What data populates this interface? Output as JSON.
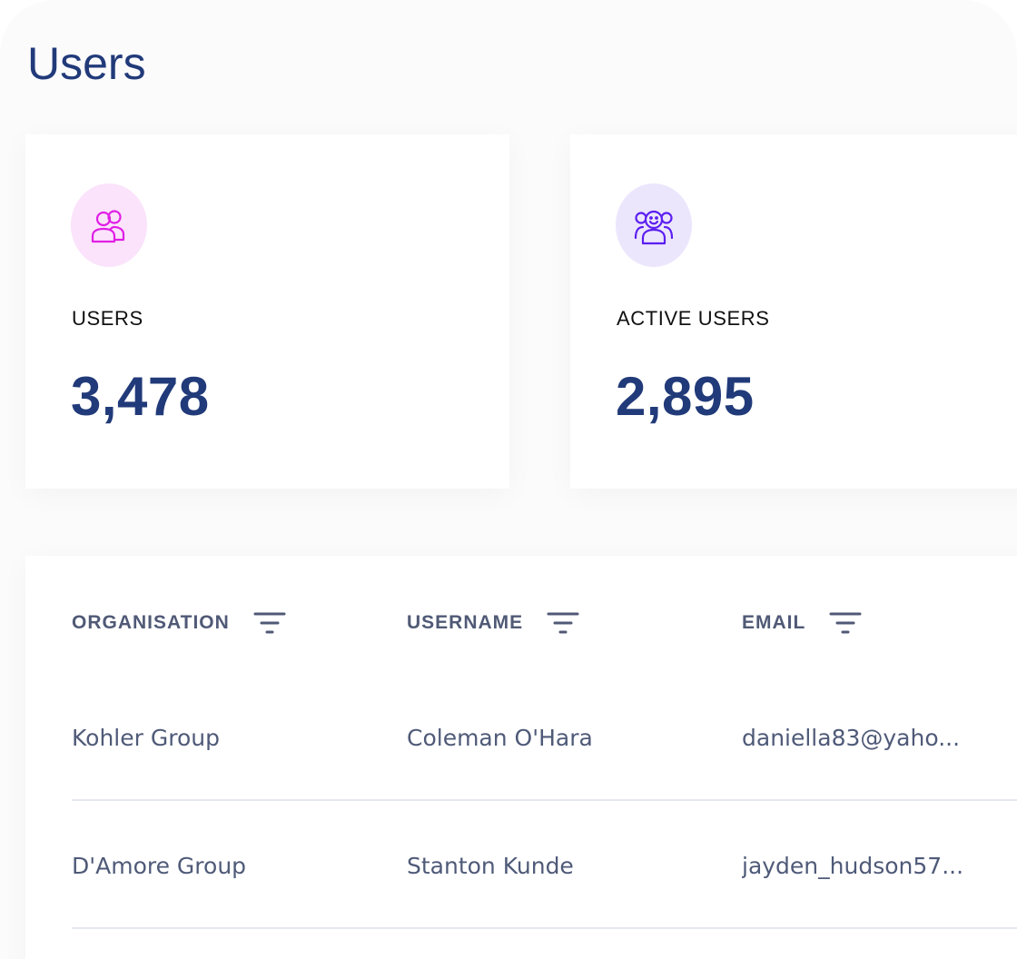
{
  "page": {
    "title": "Users"
  },
  "stats": [
    {
      "label": "USERS",
      "value": "3,478",
      "icon": "users-icon",
      "icon_color": "#e01ee6",
      "icon_bg": "#fbe3fb"
    },
    {
      "label": "ACTIVE USERS",
      "value": "2,895",
      "icon": "active-users-icon",
      "icon_color": "#5b1ef0",
      "icon_bg": "#ece6fd"
    }
  ],
  "table": {
    "columns": [
      {
        "label": "ORGANISATION",
        "icon": "filter-icon"
      },
      {
        "label": "USERNAME",
        "icon": "filter-icon"
      },
      {
        "label": "EMAIL",
        "icon": "filter-icon"
      }
    ],
    "rows": [
      {
        "organisation": "Kohler Group",
        "username": "Coleman O'Hara",
        "email": "daniella83@yaho..."
      },
      {
        "organisation": "D'Amore Group",
        "username": "Stanton Kunde",
        "email": "jayden_hudson57..."
      }
    ]
  },
  "colors": {
    "title": "#213a79",
    "header_text": "#505a76",
    "cell_text": "#4f5a78",
    "divider": "#e6e8ef"
  }
}
